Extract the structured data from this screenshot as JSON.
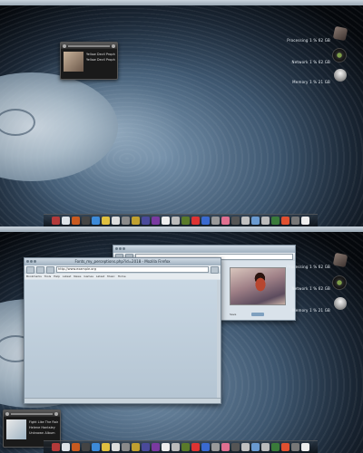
{
  "menubar": {
    "apple": "",
    "clock": ""
  },
  "top": {
    "mini_player": {
      "track": "Yellow Devil Prophesy",
      "artist": "Yellow Devil Prophesy",
      "album": ""
    },
    "gauges": [
      {
        "label": "Processing 1 % 62 GB",
        "icon": "cpu-icon"
      },
      {
        "label": "Network 1 % 62 GB",
        "icon": "network-icon"
      },
      {
        "label": "Memory 1 % 21 GB",
        "icon": "memory-icon"
      }
    ],
    "dock_running_label": "Clear_my_perceptions"
  },
  "bottom": {
    "browser": {
      "title": "Fonts_my_perceptions.php?id=2018 - Mozilla Firefox",
      "url": "http://www.example.org",
      "bookmarks": [
        "Bookmarks",
        "Tools",
        "Help",
        "Latest",
        "News",
        "Games",
        "Latest",
        "Music",
        "Home"
      ]
    },
    "photo": {
      "title": "",
      "caption": "Save",
      "url": ""
    },
    "gauges": [
      {
        "label": "Processing 1 % 62 GB",
        "icon": "cpu-icon"
      },
      {
        "label": "Network 1 % 62 GB",
        "icon": "network-icon"
      },
      {
        "label": "Memory 1 % 21 GB",
        "icon": "memory-icon"
      }
    ],
    "mini_player": {
      "track": "Fight Like The Rain",
      "artist": "Helene Hantsley",
      "album": "Unknown Album"
    }
  },
  "dock_icons": [
    "#b23a3a",
    "#dde3e8",
    "#c85a20",
    "#444",
    "#3d8ad8",
    "#e0c040",
    "#ddd",
    "#8a8a8a",
    "#c0a030",
    "#4a4a9a",
    "#7a3aa0",
    "#eee",
    "#bbb",
    "#5a7a2a",
    "#dd3333",
    "#3a6ad0",
    "#999",
    "#e07090",
    "#555",
    "#c0c0c0",
    "#6a9ad0",
    "#bbb",
    "#3a7a3a",
    "#e05030",
    "#777",
    "#eee"
  ],
  "colors": {
    "wallpaper_mid": "#3e5770",
    "titlebar": "#9fb0bf"
  }
}
